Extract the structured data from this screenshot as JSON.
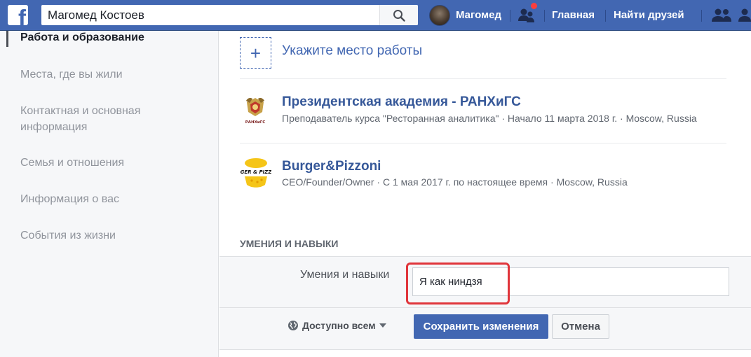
{
  "topbar": {
    "logo_glyph": "f",
    "search_value": "Магомед Костоев",
    "user_name": "Магомед",
    "nav_home": "Главная",
    "nav_find_friends": "Найти друзей",
    "brand_color": "#4267b2",
    "notification_color": "#fa3e3e"
  },
  "sidebar": {
    "items": [
      {
        "label": "Работа и образование",
        "active": true
      },
      {
        "label": "Места, где вы жили",
        "active": false
      },
      {
        "label": "Контактная и основная информация",
        "active": false
      },
      {
        "label": "Семья и отношения",
        "active": false
      },
      {
        "label": "Информация о вас",
        "active": false
      },
      {
        "label": "События из жизни",
        "active": false
      }
    ]
  },
  "work": {
    "add_icon": "+",
    "add_label": "Укажите место работы",
    "entries": [
      {
        "title": "Президентская академия - РАНХиГС",
        "subtitle": "Преподаватель курса \"Ресторанная аналитика\" · Начало 11 марта 2018 г. · Moscow, Russia",
        "logo": "ranepa-emblem-icon",
        "logo_caption": "РАНХиГС"
      },
      {
        "title": "Burger&Pizzoni",
        "subtitle": "CEO/Founder/Owner · С 1 мая 2017 г. по настоящее время · Moscow, Russia",
        "logo": "burger-pizzoni-logo-icon",
        "logo_caption": "GER & PIZZ"
      }
    ]
  },
  "skills": {
    "section_title": "УМЕНИЯ И НАВЫКИ",
    "field_label": "Умения и навыки",
    "field_value": "Я как ниндзя",
    "highlight_color": "#e0353b",
    "privacy_label": "Доступно всем",
    "save_label": "Сохранить изменения",
    "cancel_label": "Отмена"
  }
}
